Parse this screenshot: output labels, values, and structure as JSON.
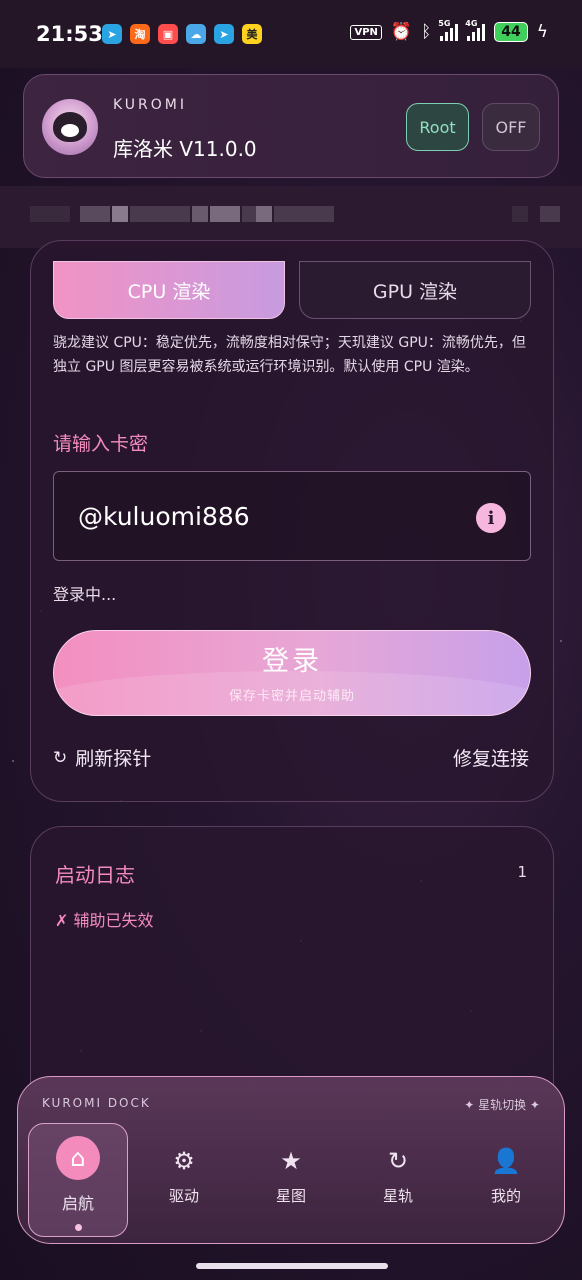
{
  "status_bar": {
    "time": "21:53",
    "app_icons": [
      {
        "name": "telegram-icon",
        "color": "#2aa3e3",
        "glyph": "➤"
      },
      {
        "name": "taobao-icon",
        "color": "#ff6a1a",
        "glyph": "淘"
      },
      {
        "name": "shopping-app-icon",
        "color": "#ff4d4d",
        "glyph": "▣"
      },
      {
        "name": "weather-icon",
        "color": "#4aa8e8",
        "glyph": "☁"
      },
      {
        "name": "telegram-icon-2",
        "color": "#2aa3e3",
        "glyph": "➤"
      },
      {
        "name": "meituan-icon",
        "color": "#ffd21f",
        "glyph": "美"
      }
    ],
    "vpn": "VPN",
    "network_5g": "5G",
    "network_4g": "4G",
    "battery": "44"
  },
  "header": {
    "brand": "KUROMI",
    "version": "库洛米 V11.0.0",
    "root_label": "Root",
    "off_label": "OFF"
  },
  "render": {
    "cpu_tab": "CPU 渲染",
    "gpu_tab": "GPU 渲染",
    "hint": "骁龙建议 CPU：稳定优先，流畅度相对保守；天玑建议 GPU：流畅优先，但独立 GPU 图层更容易被系统或运行环境识别。默认使用 CPU 渲染。"
  },
  "login": {
    "key_label": "请输入卡密",
    "key_value": "@kuluomi886",
    "status": "登录中...",
    "button_title": "登录",
    "button_sub": "保存卡密并启动辅助",
    "refresh_label": "刷新探针",
    "repair_label": "修复连接"
  },
  "log": {
    "title": "启动日志",
    "count": "1",
    "entry": "✗ 辅助已失效"
  },
  "dock": {
    "brand": "KUROMI DOCK",
    "switch_label": "✦ 星轨切换 ✦",
    "items": [
      {
        "label": "启航",
        "icon": "home-icon"
      },
      {
        "label": "驱动",
        "icon": "gear-icon"
      },
      {
        "label": "星图",
        "icon": "star-icon"
      },
      {
        "label": "星轨",
        "icon": "refresh-icon"
      },
      {
        "label": "我的",
        "icon": "user-icon"
      }
    ]
  },
  "colors": {
    "accent_pink": "#f48bbd",
    "root_green": "#8fe0c0",
    "background": "#25152e"
  }
}
